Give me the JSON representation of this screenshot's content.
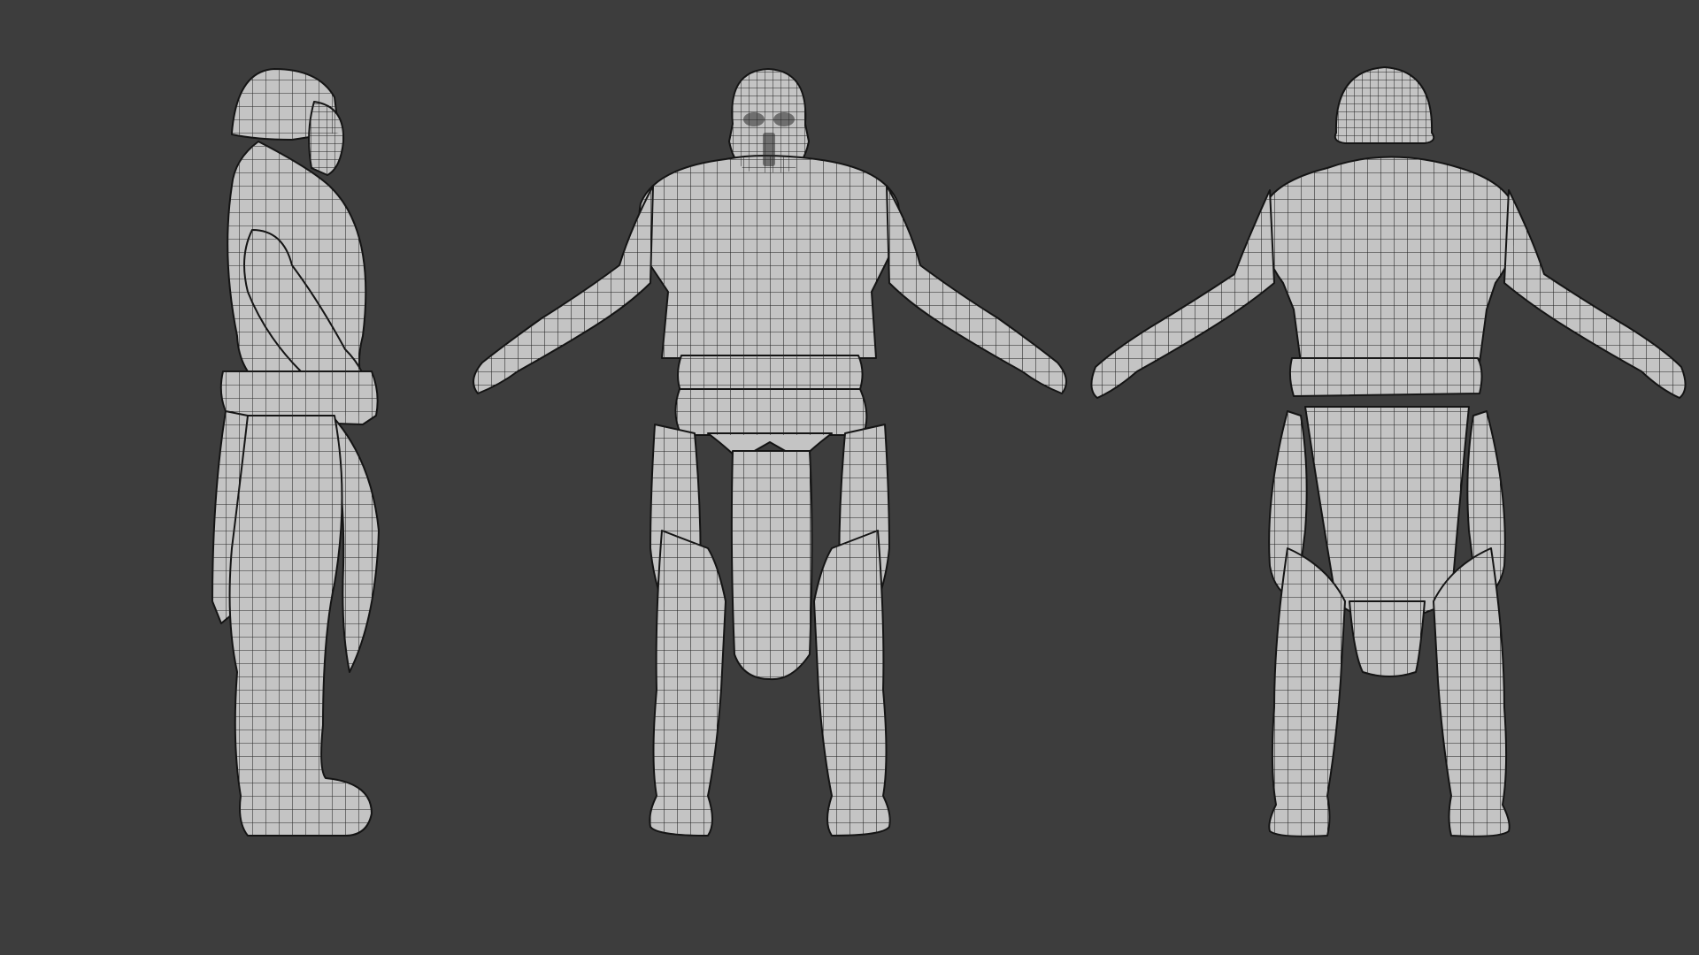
{
  "viewport": {
    "background": "#3d3d3d"
  },
  "model": {
    "mesh_color": "#c4c4c4",
    "wire_color": "#202020",
    "outline_color": "#141414",
    "views": [
      {
        "name": "side"
      },
      {
        "name": "front"
      },
      {
        "name": "back"
      }
    ]
  }
}
